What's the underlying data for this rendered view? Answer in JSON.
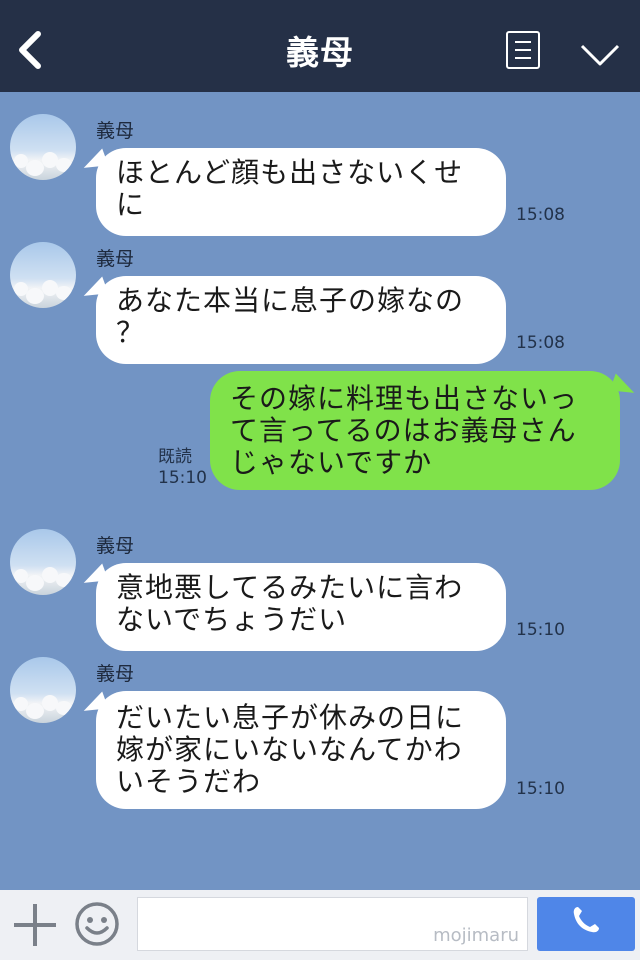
{
  "header": {
    "title": "義母",
    "back_icon": "back-chevron-icon",
    "menu_icon": "note-list-icon",
    "expand_icon": "chevron-down-icon"
  },
  "messages": [
    {
      "side": "left",
      "sender": "義母",
      "lines": [
        "ほとんど顔も出さないくせ",
        "に"
      ],
      "time": "15:08"
    },
    {
      "side": "left",
      "sender": "義母",
      "lines": [
        "あなた本当に息子の嫁なの",
        "？"
      ],
      "time": "15:08"
    },
    {
      "side": "right",
      "lines": [
        "その嫁に料理も出さないっ",
        "て言ってるのはお義母さん",
        "じゃないですか"
      ],
      "read_label": "既読",
      "time": "15:10"
    },
    {
      "side": "left",
      "sender": "義母",
      "lines": [
        "意地悪してるみたいに言わ",
        "ないでちょうだい"
      ],
      "time": "15:10"
    },
    {
      "side": "left",
      "sender": "義母",
      "lines": [
        "だいたい息子が休みの日に",
        "嫁が家にいないなんてかわ",
        "いそうだわ"
      ],
      "time": "15:10"
    }
  ],
  "footer": {
    "input_value": "",
    "watermark": "mojimaru",
    "plus_icon": "plus-icon",
    "emoji_icon": "emoji-icon",
    "call_icon": "phone-icon"
  },
  "colors": {
    "header": "#253047",
    "chat_bg": "#7294c4",
    "my_bubble": "#80e24a",
    "their_bubble": "#ffffff",
    "call_button": "#4f86e8"
  }
}
